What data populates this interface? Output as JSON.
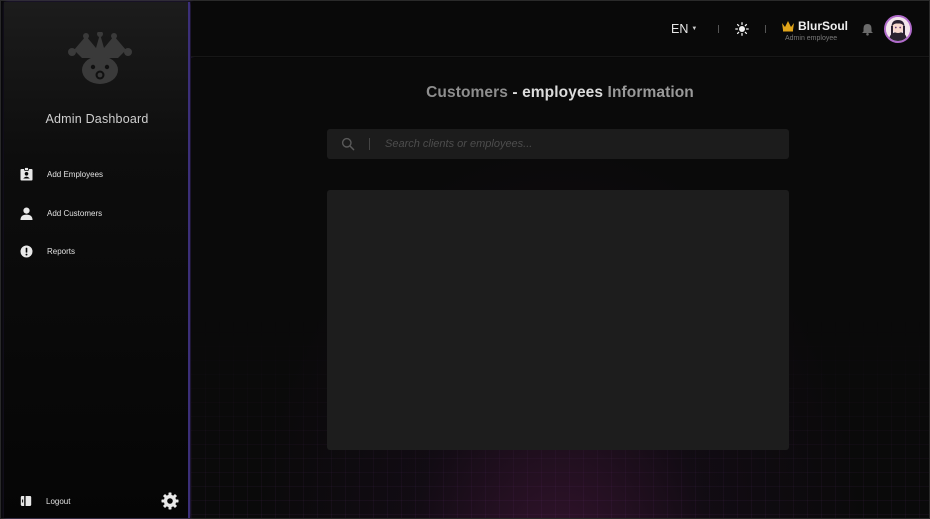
{
  "sidebar": {
    "title": "Admin Dashboard",
    "items": [
      {
        "label": "Add Employees",
        "icon": "employee-badge-icon"
      },
      {
        "label": "Add Customers",
        "icon": "person-icon"
      },
      {
        "label": "Reports",
        "icon": "alert-circle-icon"
      }
    ],
    "logout_label": "Logout",
    "accent_color": "#3b2f78"
  },
  "header": {
    "language": "EN",
    "user": {
      "name": "BlurSoul",
      "role": "Admin employee",
      "crown_color": "#e0a419"
    }
  },
  "main": {
    "title_part1": "Customers",
    "title_part2": "- employees",
    "title_part3": "Information",
    "search_placeholder": "Search clients or employees..."
  }
}
